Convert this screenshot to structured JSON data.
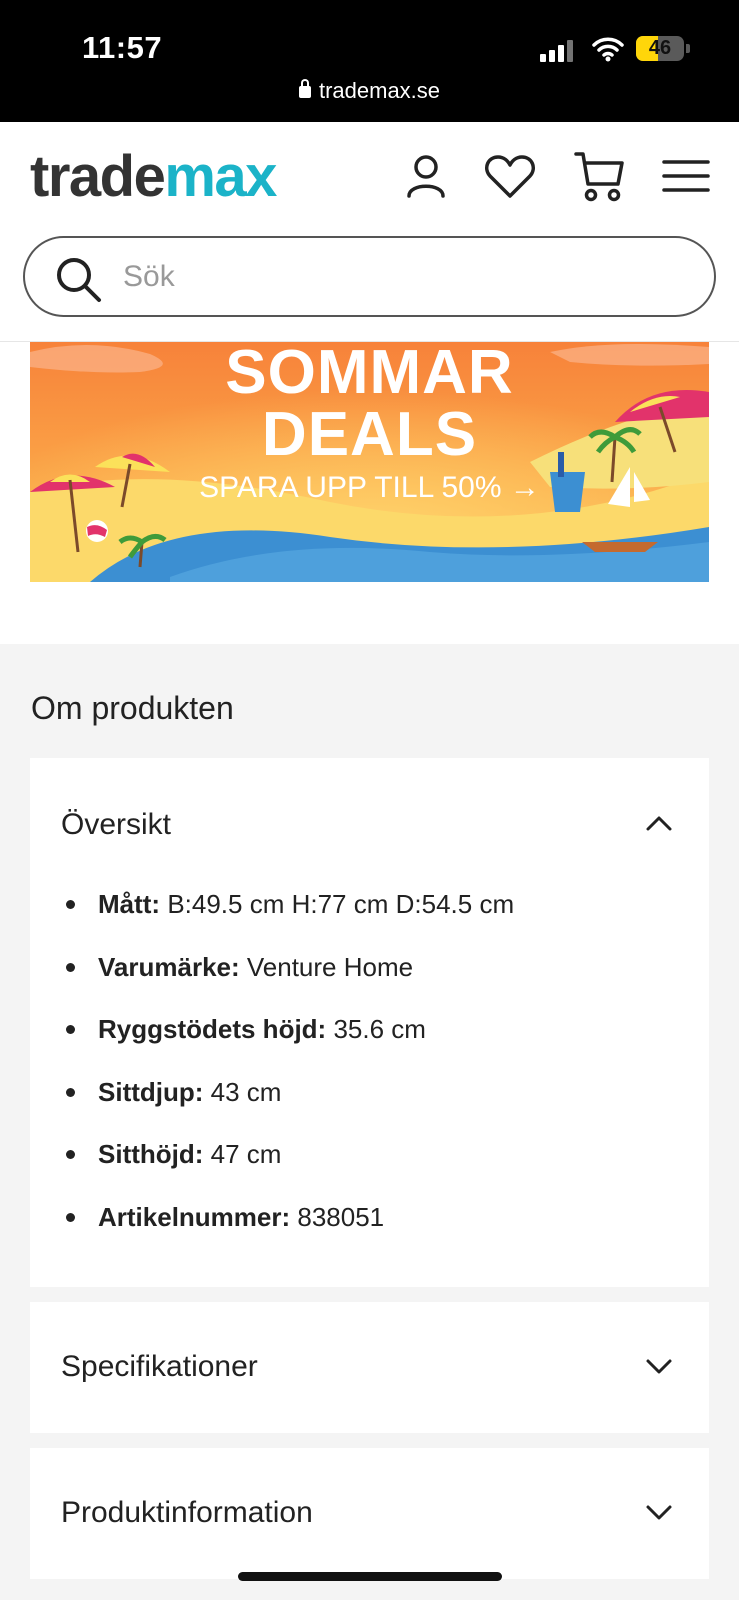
{
  "status_bar": {
    "time": "11:57",
    "url": "trademax.se",
    "battery": "46",
    "battery_level": 0.46
  },
  "header": {
    "logo_part1": "trade",
    "logo_part2": "max",
    "search_placeholder": "Sök",
    "icons": [
      "user-icon",
      "heart-icon",
      "cart-icon",
      "menu-icon"
    ]
  },
  "banner": {
    "line1": "SOMMAR",
    "line2": "DEALS",
    "subtitle": "SPARA UPP TILL 50% →"
  },
  "section": {
    "title": "Om produkten",
    "overview": {
      "title": "Översikt",
      "items": [
        {
          "label": "Mått:",
          "value": " B:49.5 cm H:77 cm D:54.5 cm"
        },
        {
          "label": "Varumärke:",
          "value": " Venture Home"
        },
        {
          "label": "Ryggstödets höjd:",
          "value": " 35.6 cm"
        },
        {
          "label": "Sittdjup:",
          "value": " 43 cm"
        },
        {
          "label": "Sitthöjd:",
          "value": " 47 cm"
        },
        {
          "label": "Artikelnummer:",
          "value": " 838051"
        }
      ]
    },
    "specs_title": "Specifikationer",
    "info_title": "Produktinformation"
  },
  "colors": {
    "brand_teal": "#1bb3c8",
    "logo_dark": "#333333",
    "banner_orange": "#f58a3c"
  }
}
